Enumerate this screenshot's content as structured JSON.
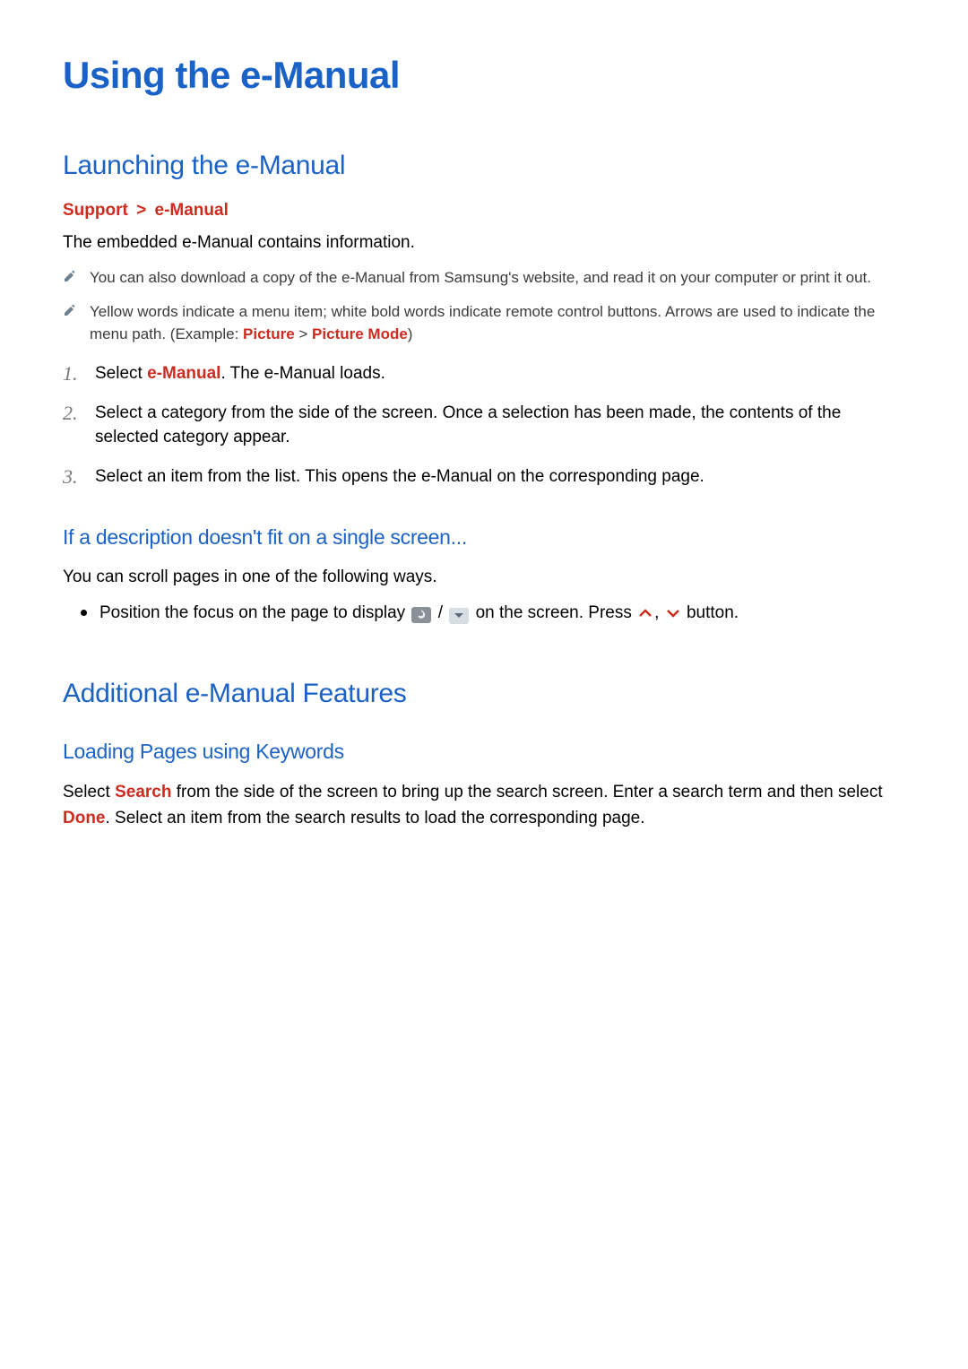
{
  "title": "Using the e-Manual",
  "section1": {
    "heading": "Launching the e-Manual",
    "breadcrumb": {
      "a": "Support",
      "sep": ">",
      "b": "e-Manual"
    },
    "intro": "The embedded e-Manual contains information.",
    "notes": [
      {
        "pre": "You can also download a copy of the e-Manual from Samsung's website, and read it on your computer or print it out."
      },
      {
        "pre": "Yellow words indicate a menu item; white bold words indicate remote control buttons. Arrows are used to indicate the menu path. (Example: ",
        "hl1": "Picture",
        "mid": " > ",
        "hl2": "Picture Mode",
        "post": ")"
      }
    ],
    "steps": [
      {
        "num": "1",
        "pre": "Select ",
        "hl": "e-Manual",
        "post": ". The e-Manual loads."
      },
      {
        "num": "2",
        "pre": "Select a category from the side of the screen. Once a selection has been made, the contents of the selected category appear.",
        "hl": "",
        "post": ""
      },
      {
        "num": "3",
        "pre": "Select an item from the list. This opens the e-Manual on the corresponding page.",
        "hl": "",
        "post": ""
      }
    ],
    "sub": {
      "heading": "If a description doesn't fit on a single screen...",
      "text": "You can scroll pages in one of the following ways.",
      "bullet": {
        "pre": "Position the focus on the page to display ",
        "mid": " / ",
        "post1": " on the screen. Press ",
        "comma": ", ",
        "post2": " button."
      }
    }
  },
  "section2": {
    "heading": "Additional e-Manual Features",
    "sub": {
      "heading": "Loading Pages using Keywords",
      "p_pre": "Select ",
      "p_hl1": "Search",
      "p_mid": " from the side of the screen to bring up the search screen. Enter a search term and then select ",
      "p_hl2": "Done",
      "p_post": ". Select an item from the search results to load the corresponding page."
    }
  },
  "chart_data": null
}
